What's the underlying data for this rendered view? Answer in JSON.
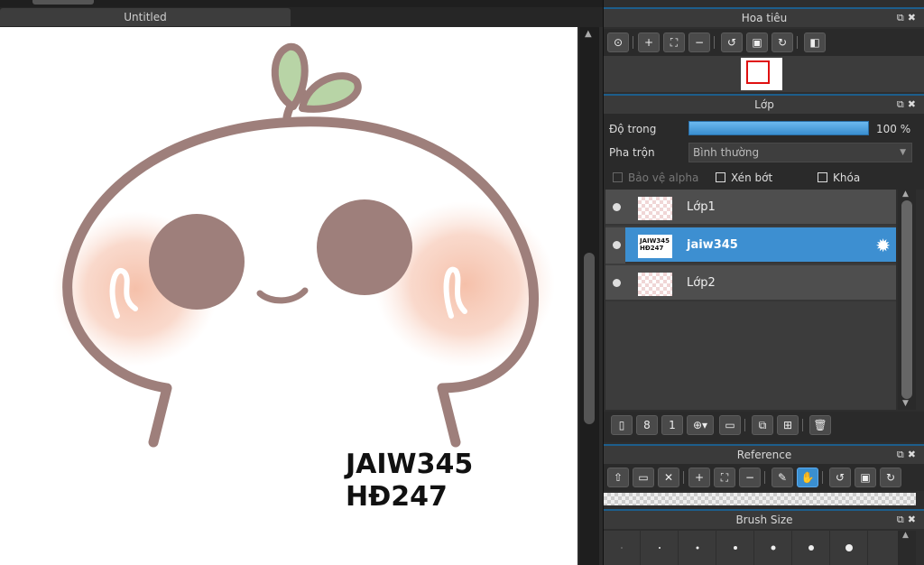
{
  "document": {
    "tab_title": "Untitled"
  },
  "canvas": {
    "drawn_text_line1": "JAIW345",
    "drawn_text_line2": "HĐ247"
  },
  "navigator": {
    "title": "Hoa tiêu",
    "tools": [
      "zoom-actual-icon",
      "zoom-in-icon",
      "fit-icon",
      "zoom-out-icon",
      "rotate-left-icon",
      "reset-icon",
      "rotate-right-icon",
      "flip-icon"
    ]
  },
  "layers": {
    "title": "Lớp",
    "opacity_label": "Độ trong",
    "opacity_value": "100 %",
    "opacity_fraction": 1.0,
    "blend_label": "Pha trộn",
    "blend_value": "Bình thường",
    "protect_alpha": "Bảo vệ alpha",
    "clipping": "Xén bớt",
    "lock": "Khóa",
    "items": [
      {
        "name": "Lớp1",
        "selected": false
      },
      {
        "name": "jaiw345",
        "selected": true,
        "thumb_text": "JAIW345 HĐ247"
      },
      {
        "name": "Lớp2",
        "selected": false
      }
    ]
  },
  "reference": {
    "title": "Reference"
  },
  "brush_size": {
    "title": "Brush Size"
  },
  "colors": {
    "accent": "#3d8fd1",
    "panel_bg": "#2e2e2e",
    "title_bar": "#3a3a3a"
  }
}
